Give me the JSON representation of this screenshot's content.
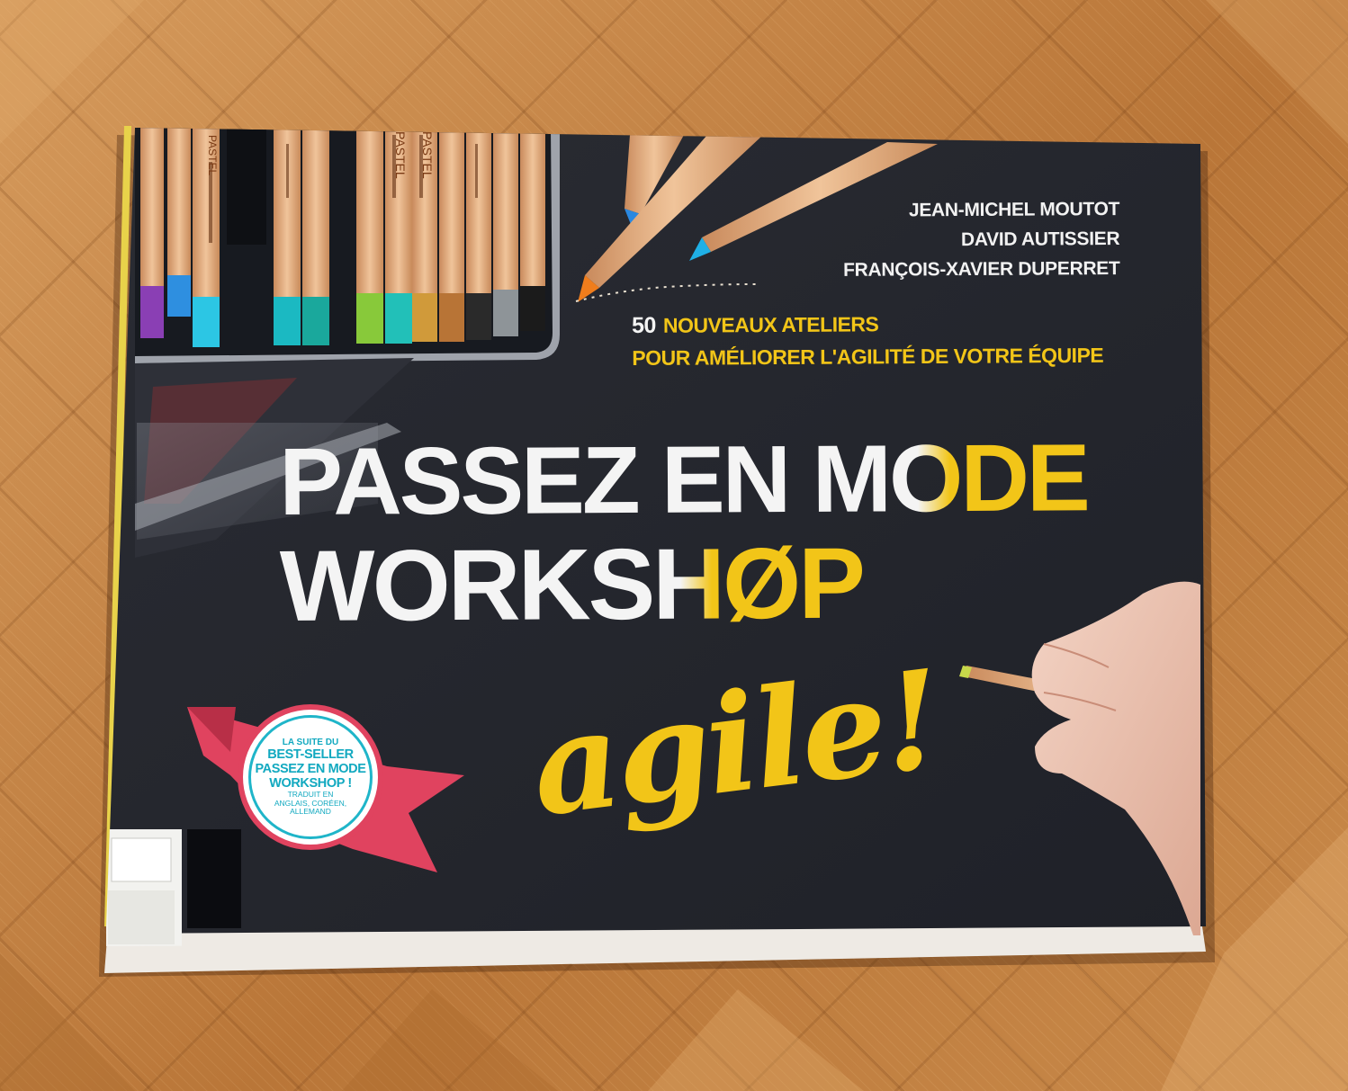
{
  "book": {
    "authors": [
      "JEAN-MICHEL MOUTOT",
      "DAVID AUTISSIER",
      "FRANÇOIS-XAVIER DUPERRET"
    ],
    "tagline": {
      "number": "50",
      "line1": "NOUVEAUX ATELIERS",
      "line2": "POUR AMÉLIORER L'AGILITÉ DE VOTRE ÉQUIPE"
    },
    "title": {
      "line1_white": "PASSEZ EN M",
      "line1_mixed": "O",
      "line1_yellow": "DE",
      "line2_white": "WORKS",
      "line2_mixed": "H",
      "line2_yellow": "ØP",
      "script": "agile!"
    },
    "badge": {
      "line1": "LA SUITE DU",
      "line2": "BEST-SELLER",
      "line3": "PASSEZ EN MODE",
      "line4": "WORKSHOP !",
      "line5": "TRADUIT EN",
      "line6": "ANGLAIS, CORÉEN,",
      "line7": "ALLEMAND"
    },
    "pencil_print": {
      "label_a": "PASTEL",
      "label_b": "PASTEL",
      "label_c": "PASTEL"
    }
  },
  "colors": {
    "cover": "#24262d",
    "accent_yellow": "#f2c518",
    "badge_ribbon": "#e0435f",
    "badge_teal": "#1fb5c9",
    "floor": "#c9894a"
  }
}
